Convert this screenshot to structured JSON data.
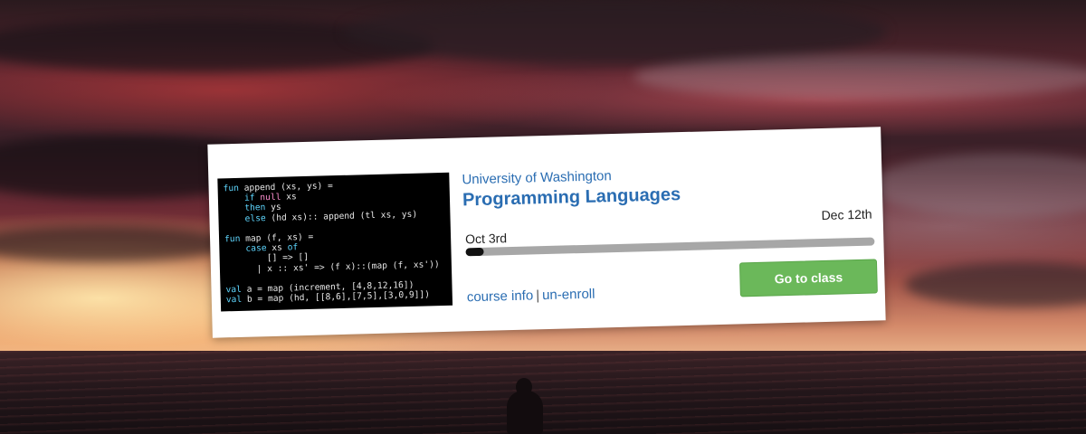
{
  "colors": {
    "link": "#2a6db2",
    "button_bg": "#6bb85a",
    "button_text": "#ffffff",
    "progress_track": "#a7a7a7",
    "progress_fill": "#111111"
  },
  "card": {
    "institution": "University of Washington",
    "course_title": "Programming Languages",
    "start_date": "Oct 3rd",
    "end_date": "Dec 12th",
    "progress_fraction": 0.045,
    "links": {
      "course_info": "course info",
      "separator": "|",
      "unenroll": "un-enroll"
    },
    "go_button": "Go to class",
    "thumbnail": {
      "code_lines": [
        "fun append (xs, ys) =",
        "    if null xs",
        "    then ys",
        "    else (hd xs):: append (tl xs, ys)",
        "",
        "fun map (f, xs) =",
        "    case xs of",
        "        [] => []",
        "      | x :: xs' => (f x)::(map (f, xs'))",
        "",
        "val a = map (increment, [4,8,12,16])",
        "val b = map (hd, [[8,6],[7,5],[3,0,9]])"
      ]
    }
  }
}
